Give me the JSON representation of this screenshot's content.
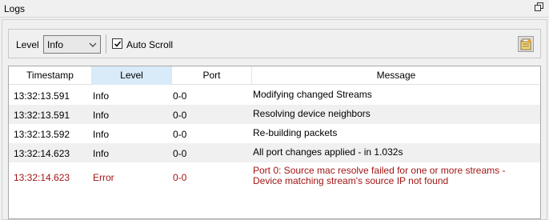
{
  "window": {
    "title": "Logs"
  },
  "toolbar": {
    "level_label": "Level",
    "level_value": "Info",
    "auto_scroll_label": "Auto Scroll",
    "auto_scroll_checked": true
  },
  "table": {
    "columns": [
      "Timestamp",
      "Level",
      "Port",
      "Message"
    ],
    "rows": [
      {
        "timestamp": "13:32:13.591",
        "level": "Info",
        "port": "0-0",
        "message": "Modifying changed Streams"
      },
      {
        "timestamp": "13:32:13.591",
        "level": "Info",
        "port": "0-0",
        "message": "Resolving device neighbors"
      },
      {
        "timestamp": "13:32:13.592",
        "level": "Info",
        "port": "0-0",
        "message": "Re-building packets"
      },
      {
        "timestamp": "13:32:14.623",
        "level": "Info",
        "port": "0-0",
        "message": "All port changes applied - in 1.032s"
      },
      {
        "timestamp": "13:32:14.623",
        "level": "Error",
        "port": "0-0",
        "message": "Port 0: Source mac resolve failed for one or more streams - Device matching stream's source IP not found"
      }
    ]
  },
  "colors": {
    "error_text": "#a31515",
    "selected_header": "#d9ebf9",
    "alt_row": "#f0f0f0"
  }
}
